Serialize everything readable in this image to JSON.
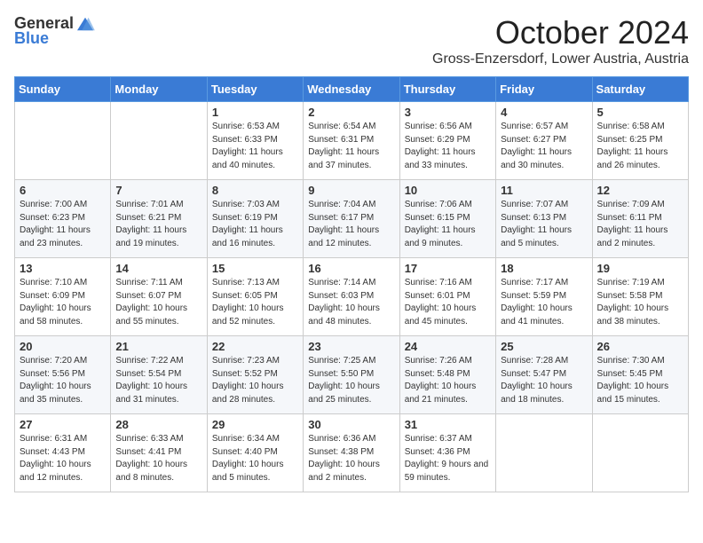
{
  "header": {
    "logo_general": "General",
    "logo_blue": "Blue",
    "month_title": "October 2024",
    "location": "Gross-Enzersdorf, Lower Austria, Austria"
  },
  "weekdays": [
    "Sunday",
    "Monday",
    "Tuesday",
    "Wednesday",
    "Thursday",
    "Friday",
    "Saturday"
  ],
  "weeks": [
    [
      {
        "day": "",
        "sunrise": "",
        "sunset": "",
        "daylight": ""
      },
      {
        "day": "",
        "sunrise": "",
        "sunset": "",
        "daylight": ""
      },
      {
        "day": "1",
        "sunrise": "Sunrise: 6:53 AM",
        "sunset": "Sunset: 6:33 PM",
        "daylight": "Daylight: 11 hours and 40 minutes."
      },
      {
        "day": "2",
        "sunrise": "Sunrise: 6:54 AM",
        "sunset": "Sunset: 6:31 PM",
        "daylight": "Daylight: 11 hours and 37 minutes."
      },
      {
        "day": "3",
        "sunrise": "Sunrise: 6:56 AM",
        "sunset": "Sunset: 6:29 PM",
        "daylight": "Daylight: 11 hours and 33 minutes."
      },
      {
        "day": "4",
        "sunrise": "Sunrise: 6:57 AM",
        "sunset": "Sunset: 6:27 PM",
        "daylight": "Daylight: 11 hours and 30 minutes."
      },
      {
        "day": "5",
        "sunrise": "Sunrise: 6:58 AM",
        "sunset": "Sunset: 6:25 PM",
        "daylight": "Daylight: 11 hours and 26 minutes."
      }
    ],
    [
      {
        "day": "6",
        "sunrise": "Sunrise: 7:00 AM",
        "sunset": "Sunset: 6:23 PM",
        "daylight": "Daylight: 11 hours and 23 minutes."
      },
      {
        "day": "7",
        "sunrise": "Sunrise: 7:01 AM",
        "sunset": "Sunset: 6:21 PM",
        "daylight": "Daylight: 11 hours and 19 minutes."
      },
      {
        "day": "8",
        "sunrise": "Sunrise: 7:03 AM",
        "sunset": "Sunset: 6:19 PM",
        "daylight": "Daylight: 11 hours and 16 minutes."
      },
      {
        "day": "9",
        "sunrise": "Sunrise: 7:04 AM",
        "sunset": "Sunset: 6:17 PM",
        "daylight": "Daylight: 11 hours and 12 minutes."
      },
      {
        "day": "10",
        "sunrise": "Sunrise: 7:06 AM",
        "sunset": "Sunset: 6:15 PM",
        "daylight": "Daylight: 11 hours and 9 minutes."
      },
      {
        "day": "11",
        "sunrise": "Sunrise: 7:07 AM",
        "sunset": "Sunset: 6:13 PM",
        "daylight": "Daylight: 11 hours and 5 minutes."
      },
      {
        "day": "12",
        "sunrise": "Sunrise: 7:09 AM",
        "sunset": "Sunset: 6:11 PM",
        "daylight": "Daylight: 11 hours and 2 minutes."
      }
    ],
    [
      {
        "day": "13",
        "sunrise": "Sunrise: 7:10 AM",
        "sunset": "Sunset: 6:09 PM",
        "daylight": "Daylight: 10 hours and 58 minutes."
      },
      {
        "day": "14",
        "sunrise": "Sunrise: 7:11 AM",
        "sunset": "Sunset: 6:07 PM",
        "daylight": "Daylight: 10 hours and 55 minutes."
      },
      {
        "day": "15",
        "sunrise": "Sunrise: 7:13 AM",
        "sunset": "Sunset: 6:05 PM",
        "daylight": "Daylight: 10 hours and 52 minutes."
      },
      {
        "day": "16",
        "sunrise": "Sunrise: 7:14 AM",
        "sunset": "Sunset: 6:03 PM",
        "daylight": "Daylight: 10 hours and 48 minutes."
      },
      {
        "day": "17",
        "sunrise": "Sunrise: 7:16 AM",
        "sunset": "Sunset: 6:01 PM",
        "daylight": "Daylight: 10 hours and 45 minutes."
      },
      {
        "day": "18",
        "sunrise": "Sunrise: 7:17 AM",
        "sunset": "Sunset: 5:59 PM",
        "daylight": "Daylight: 10 hours and 41 minutes."
      },
      {
        "day": "19",
        "sunrise": "Sunrise: 7:19 AM",
        "sunset": "Sunset: 5:58 PM",
        "daylight": "Daylight: 10 hours and 38 minutes."
      }
    ],
    [
      {
        "day": "20",
        "sunrise": "Sunrise: 7:20 AM",
        "sunset": "Sunset: 5:56 PM",
        "daylight": "Daylight: 10 hours and 35 minutes."
      },
      {
        "day": "21",
        "sunrise": "Sunrise: 7:22 AM",
        "sunset": "Sunset: 5:54 PM",
        "daylight": "Daylight: 10 hours and 31 minutes."
      },
      {
        "day": "22",
        "sunrise": "Sunrise: 7:23 AM",
        "sunset": "Sunset: 5:52 PM",
        "daylight": "Daylight: 10 hours and 28 minutes."
      },
      {
        "day": "23",
        "sunrise": "Sunrise: 7:25 AM",
        "sunset": "Sunset: 5:50 PM",
        "daylight": "Daylight: 10 hours and 25 minutes."
      },
      {
        "day": "24",
        "sunrise": "Sunrise: 7:26 AM",
        "sunset": "Sunset: 5:48 PM",
        "daylight": "Daylight: 10 hours and 21 minutes."
      },
      {
        "day": "25",
        "sunrise": "Sunrise: 7:28 AM",
        "sunset": "Sunset: 5:47 PM",
        "daylight": "Daylight: 10 hours and 18 minutes."
      },
      {
        "day": "26",
        "sunrise": "Sunrise: 7:30 AM",
        "sunset": "Sunset: 5:45 PM",
        "daylight": "Daylight: 10 hours and 15 minutes."
      }
    ],
    [
      {
        "day": "27",
        "sunrise": "Sunrise: 6:31 AM",
        "sunset": "Sunset: 4:43 PM",
        "daylight": "Daylight: 10 hours and 12 minutes."
      },
      {
        "day": "28",
        "sunrise": "Sunrise: 6:33 AM",
        "sunset": "Sunset: 4:41 PM",
        "daylight": "Daylight: 10 hours and 8 minutes."
      },
      {
        "day": "29",
        "sunrise": "Sunrise: 6:34 AM",
        "sunset": "Sunset: 4:40 PM",
        "daylight": "Daylight: 10 hours and 5 minutes."
      },
      {
        "day": "30",
        "sunrise": "Sunrise: 6:36 AM",
        "sunset": "Sunset: 4:38 PM",
        "daylight": "Daylight: 10 hours and 2 minutes."
      },
      {
        "day": "31",
        "sunrise": "Sunrise: 6:37 AM",
        "sunset": "Sunset: 4:36 PM",
        "daylight": "Daylight: 9 hours and 59 minutes."
      },
      {
        "day": "",
        "sunrise": "",
        "sunset": "",
        "daylight": ""
      },
      {
        "day": "",
        "sunrise": "",
        "sunset": "",
        "daylight": ""
      }
    ]
  ]
}
